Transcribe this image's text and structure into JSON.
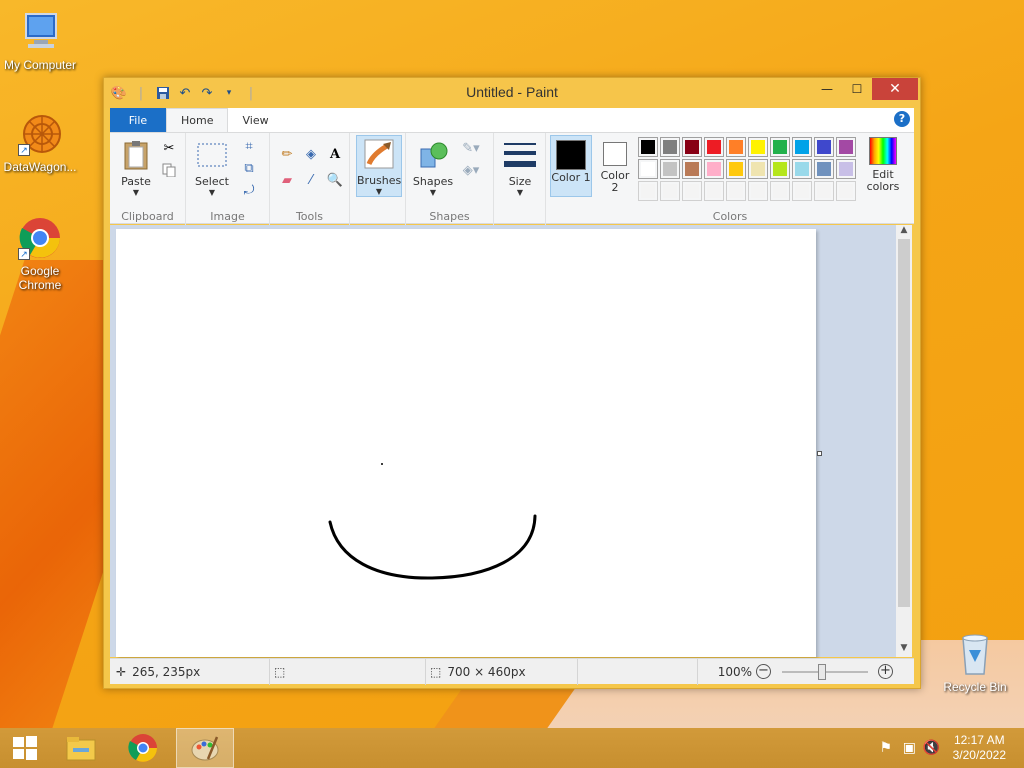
{
  "desktop": {
    "icons": [
      {
        "label": "My Computer"
      },
      {
        "label": "DataWagon..."
      },
      {
        "label": "Google Chrome"
      },
      {
        "label": "Recycle Bin"
      }
    ]
  },
  "window": {
    "title": "Untitled - Paint",
    "tabs": [
      {
        "label": "File"
      },
      {
        "label": "Home"
      },
      {
        "label": "View"
      }
    ],
    "ribbon": {
      "clipboard": {
        "paste": "Paste",
        "label": "Clipboard"
      },
      "image": {
        "select": "Select",
        "label": "Image"
      },
      "tools": {
        "label": "Tools"
      },
      "brushes": {
        "label": "Brushes"
      },
      "shapes": {
        "shapes": "Shapes",
        "label": "Shapes"
      },
      "size": {
        "label": "Size"
      },
      "colors": {
        "color1": "Color 1",
        "color2": "Color 2",
        "edit": "Edit colors",
        "label": "Colors",
        "color1_value": "#000000",
        "color2_value": "#ffffff",
        "row1": [
          "#000000",
          "#7f7f7f",
          "#880015",
          "#ed1c24",
          "#ff7f27",
          "#fff200",
          "#22b14c",
          "#00a2e8",
          "#3f48cc",
          "#a349a4"
        ],
        "row2": [
          "#ffffff",
          "#c3c3c3",
          "#b97a57",
          "#ffaec9",
          "#ffc90e",
          "#efe4b0",
          "#b5e61d",
          "#99d9ea",
          "#7092be",
          "#c8bfe7"
        ],
        "row3": [
          "#f4f4f4",
          "#f4f4f4",
          "#f4f4f4",
          "#f4f4f4",
          "#f4f4f4",
          "#f4f4f4",
          "#f4f4f4",
          "#f4f4f4",
          "#f4f4f4",
          "#f4f4f4"
        ]
      }
    },
    "status": {
      "cursor_pos": "265, 235px",
      "image_size": "700 × 460px",
      "zoom": "100%"
    }
  },
  "taskbar": {
    "time": "12:17 AM",
    "date": "3/20/2022"
  }
}
